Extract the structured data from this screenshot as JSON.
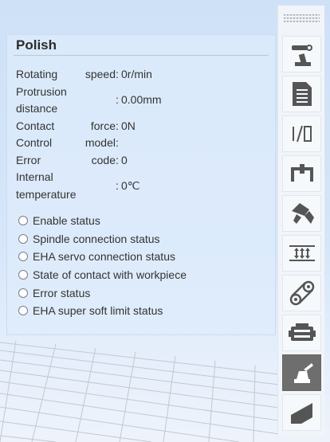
{
  "panel": {
    "title": "Polish",
    "rows": [
      {
        "label_a": "Rotating",
        "label_b": "speed",
        "value": "0r/min"
      },
      {
        "label_a": "Protrusion",
        "label_b": "distance",
        "value": "0.00mm"
      },
      {
        "label_a": "Contact",
        "label_b": "force",
        "value": "0N"
      },
      {
        "label_a": "Control",
        "label_b": "model",
        "value": ""
      },
      {
        "label_a": "Error",
        "label_b": "code",
        "value": "0"
      },
      {
        "label_a": "Internal",
        "label_b": "temperature",
        "value": "0℃"
      }
    ],
    "statuses": [
      "Enable status",
      "Spindle connection status",
      "EHA servo connection status",
      "State of contact with workpiece",
      "Error status",
      "EHA super soft limit status"
    ]
  },
  "toolbar": {
    "items": [
      {
        "icon": "robot-arm-icon",
        "active": false
      },
      {
        "icon": "document-icon",
        "active": false
      },
      {
        "icon": "io-icon",
        "active": false
      },
      {
        "icon": "gripper-icon",
        "active": false
      },
      {
        "icon": "end-effector-icon",
        "active": false
      },
      {
        "icon": "conveyor-icon",
        "active": false
      },
      {
        "icon": "chain-icon",
        "active": false
      },
      {
        "icon": "motor-icon",
        "active": false
      },
      {
        "icon": "polish-tool-icon",
        "active": true
      },
      {
        "icon": "coordinate-icon",
        "active": false
      }
    ]
  },
  "colors": {
    "panel_bg": "#deecfb",
    "active_tool": "#6e6e6e",
    "icon": "#555555"
  }
}
